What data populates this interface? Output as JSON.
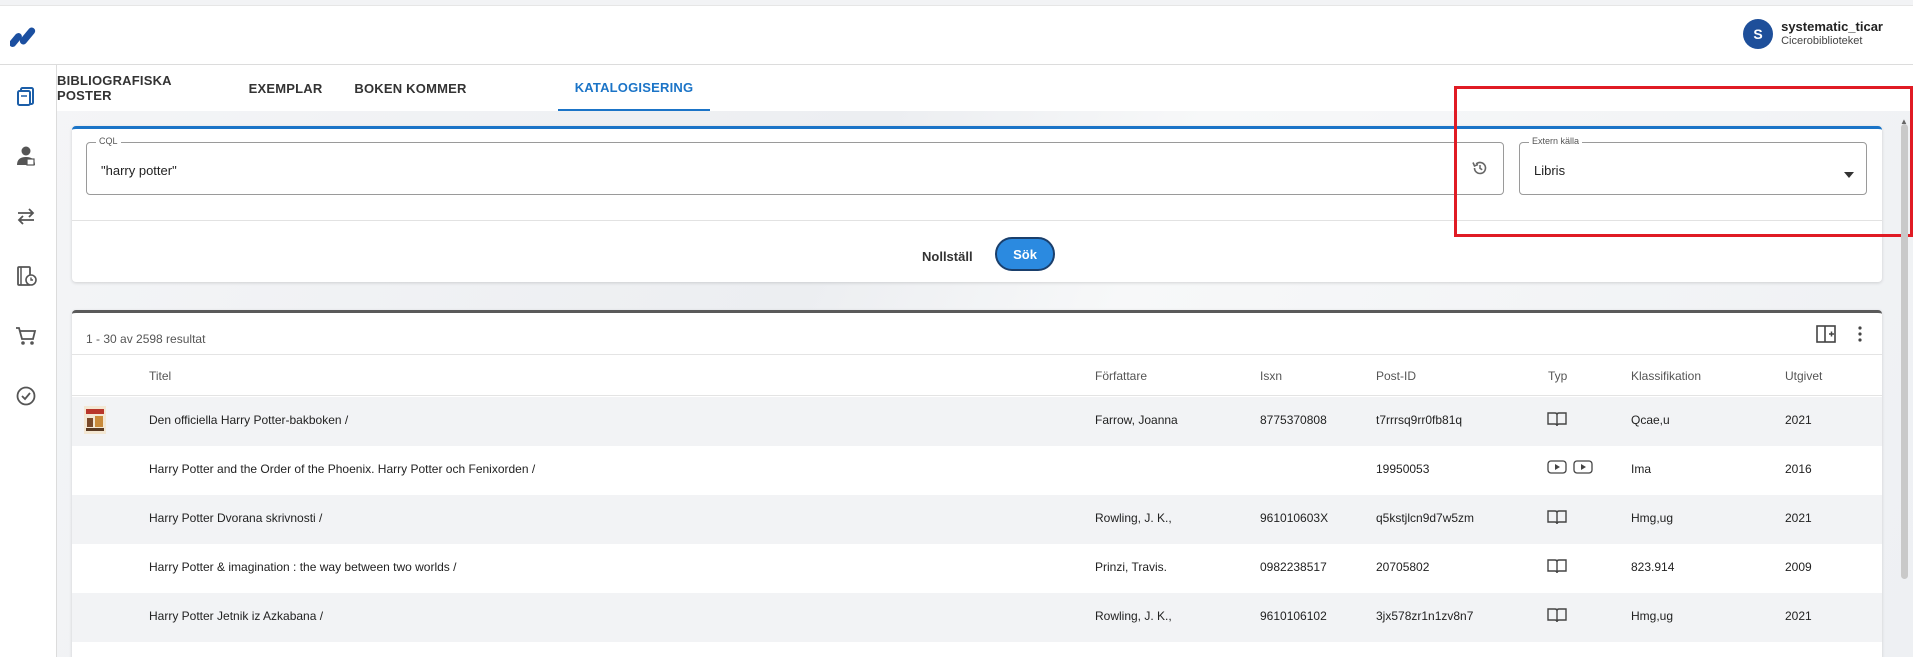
{
  "header": {
    "logo_icon": "app-logo-icon",
    "user": {
      "initial": "S",
      "name": "systematic_ticar",
      "library": "Cicerobiblioteket"
    }
  },
  "sidebar": {
    "items": [
      {
        "icon": "books-icon"
      },
      {
        "icon": "patron-icon"
      },
      {
        "icon": "transfer-icon"
      },
      {
        "icon": "book-clock-icon"
      },
      {
        "icon": "cart-icon"
      },
      {
        "icon": "check-circle-icon"
      }
    ]
  },
  "tabs": [
    {
      "label": "BIBLIOGRAFISKA POSTER",
      "active": false
    },
    {
      "label": "EXEMPLAR",
      "active": false
    },
    {
      "label": "BOKEN KOMMER",
      "active": false
    },
    {
      "label": "KATALOGISERING",
      "active": true
    }
  ],
  "search": {
    "cql_label": "CQL",
    "cql_value": "\"harry potter\"",
    "history_icon": "history-icon",
    "source_label": "Extern källa",
    "source_value": "Libris",
    "reset_label": "Nollställ",
    "search_label": "Sök"
  },
  "results": {
    "count_text": "1 - 30 av 2598 resultat",
    "columns": [
      "Titel",
      "Författare",
      "Isxn",
      "Post-ID",
      "Typ",
      "Klassifikation",
      "Utgivet"
    ],
    "rows": [
      {
        "has_cover": true,
        "title": "Den officiella Harry Potter-bakboken /",
        "author": "Farrow, Joanna",
        "isxn": "8775370808",
        "post_id": "t7rrrsq9rr0fb81q",
        "types": [
          "book-icon"
        ],
        "class": "Qcae,u",
        "year": "2021"
      },
      {
        "has_cover": false,
        "title": "Harry Potter and the Order of the Phoenix. Harry Potter och Fenixorden /",
        "author": "",
        "isxn": "",
        "post_id": "19950053",
        "types": [
          "video-icon",
          "video-icon"
        ],
        "class": "Ima",
        "year": "2016"
      },
      {
        "has_cover": false,
        "title": "Harry Potter Dvorana skrivnosti /",
        "author": "Rowling, J. K.,",
        "isxn": "961010603X",
        "post_id": "q5kstjlcn9d7w5zm",
        "types": [
          "book-icon"
        ],
        "class": "Hmg,ug",
        "year": "2021"
      },
      {
        "has_cover": false,
        "title": "Harry Potter & imagination : the way between two worlds /",
        "author": "Prinzi, Travis.",
        "isxn": "0982238517",
        "post_id": "20705802",
        "types": [
          "book-icon"
        ],
        "class": "823.914",
        "year": "2009"
      },
      {
        "has_cover": false,
        "title": "Harry Potter Jetnik iz Azkabana /",
        "author": "Rowling, J. K.,",
        "isxn": "9610106102",
        "post_id": "3jx578zr1n1zv8n7",
        "types": [
          "book-icon"
        ],
        "class": "Hmg,ug",
        "year": "2021"
      }
    ]
  },
  "colors": {
    "accent": "#1b74c7",
    "search_button": "#2b8ae0",
    "highlight": "#e01b24",
    "avatar": "#1e4f9a"
  }
}
